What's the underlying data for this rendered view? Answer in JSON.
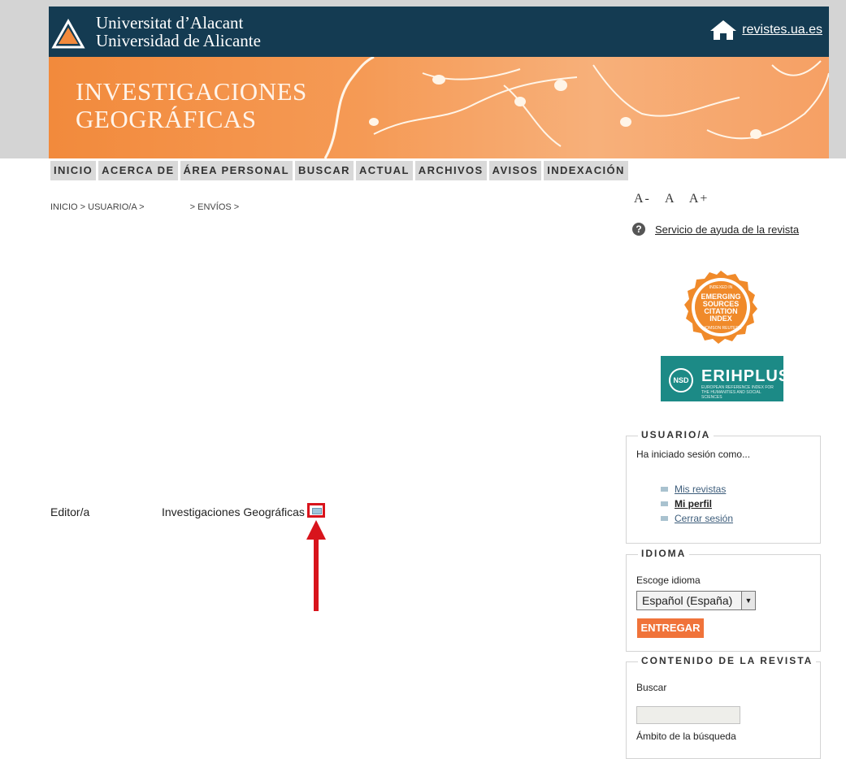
{
  "header": {
    "university_line1": "Universitat d’Alacant",
    "university_line2": "Universidad de Alicante",
    "home_link": "revistes.ua.es"
  },
  "banner": {
    "title_line1": "INVESTIGACIONES",
    "title_line2": "GEOGRÁFICAS"
  },
  "nav": {
    "items": [
      "INICIO",
      "ACERCA DE",
      "ÁREA PERSONAL",
      "BUSCAR",
      "ACTUAL",
      "ARCHIVOS",
      "AVISOS",
      "INDEXACIÓN"
    ]
  },
  "breadcrumb": {
    "part1": "INICIO > USUARIO/A >",
    "part2": "> ENVÍOS >"
  },
  "main": {
    "role": "Editor/a",
    "journal": "Investigaciones Geográficas"
  },
  "sidebar": {
    "font_sizer": [
      "A-",
      "A",
      "A+"
    ],
    "help_link": "Servicio de ayuda de la revista",
    "esci_badge": {
      "top": "INDEXED IN",
      "line1": "EMERGING",
      "line2": "SOURCES",
      "line3": "CITATION",
      "line4": "INDEX",
      "bottom": "THOMSON REUTERS"
    },
    "erih_logo": {
      "nsd": "NSD",
      "text": "ERIHPLUS",
      "sub": "EUROPEAN REFERENCE INDEX FOR THE HUMANITIES AND SOCIAL SCIENCES"
    },
    "user_block": {
      "title": "USUARIO/A",
      "logged_in": "Ha iniciado sesión como...",
      "links": [
        "Mis revistas",
        "Mi perfil",
        "Cerrar sesión"
      ]
    },
    "language_block": {
      "title": "IDIOMA",
      "label": "Escoge idioma",
      "selected": "Español (España)",
      "submit": "ENTREGAR"
    },
    "content_block": {
      "title": "CONTENIDO DE LA REVISTA",
      "search_label": "Buscar",
      "scope_label": "Ámbito de la búsqueda"
    }
  }
}
